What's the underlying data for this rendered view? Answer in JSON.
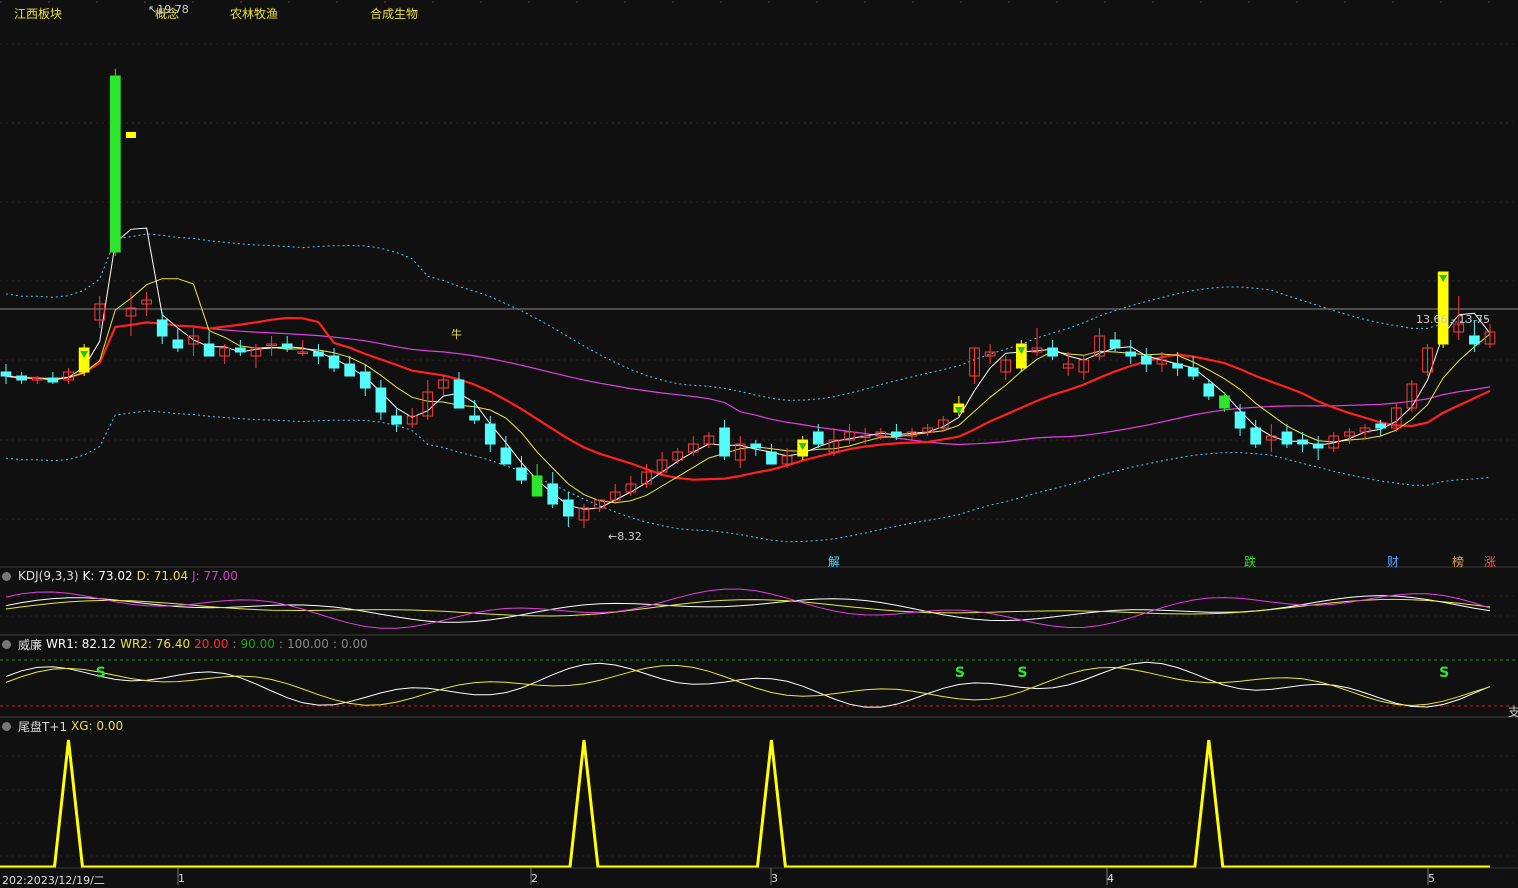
{
  "sector_labels": [
    "江西板块",
    "概念",
    "农林牧渔",
    "合成生物"
  ],
  "price_labels": {
    "high": "19.78",
    "low": "8.32",
    "cursor": "13.66 - 13.75"
  },
  "event_tags": [
    {
      "text": "解",
      "color": "#4fd6ff"
    },
    {
      "text": "跌",
      "color": "#2ee62e"
    },
    {
      "text": "财",
      "color": "#4fa6ff"
    },
    {
      "text": "榜",
      "color": "#e0a050"
    },
    {
      "text": "涨",
      "color": "#ff5050"
    }
  ],
  "niu_label": "牛",
  "kdj": {
    "name": "KDJ(9,3,3)",
    "k": "K: 73.02",
    "d": "D: 71.04",
    "j": "J: 77.00"
  },
  "wr": {
    "name": "威廉",
    "wr1": "WR1: 82.12",
    "wr2": "WR2: 76.40",
    "l20": "20.00",
    "l90": "90.00",
    "l100": "100.00",
    "l0": "0.00",
    "side": "支"
  },
  "tail": {
    "name": "尾盘T+1",
    "xg": "XG: 0.00"
  },
  "x_axis": {
    "date": "202:2023/12/19/二",
    "months": [
      "1",
      "2",
      "3",
      "4",
      "5"
    ]
  },
  "colors": {
    "up": "#ff3b3b",
    "down": "#54fcfc",
    "signal": "#ffff00",
    "ma_red": "#ff2020",
    "ma_magenta": "#e040e0",
    "ma_yellow": "#e8e840",
    "ma_white": "#ffffff",
    "boll": "#58c8e8"
  },
  "chart_data": {
    "type": "candlestick",
    "candles": [
      [
        12.2,
        12.4,
        11.9,
        12.1
      ],
      [
        12.1,
        12.2,
        11.9,
        12.0
      ],
      [
        12.0,
        12.1,
        11.9,
        12.05
      ],
      [
        12.05,
        12.2,
        11.9,
        11.95
      ],
      [
        12.0,
        12.3,
        11.9,
        12.2
      ],
      [
        12.2,
        12.9,
        12.1,
        12.8
      ],
      [
        13.5,
        14.1,
        13.3,
        13.9
      ],
      [
        15.2,
        19.78,
        15.1,
        19.6
      ],
      [
        13.6,
        14.2,
        13.1,
        13.8
      ],
      [
        13.9,
        14.2,
        13.6,
        14.0
      ],
      [
        13.5,
        13.7,
        12.9,
        13.1
      ],
      [
        13.0,
        13.3,
        12.7,
        12.8
      ],
      [
        12.9,
        13.3,
        12.6,
        13.1
      ],
      [
        12.9,
        13.2,
        12.7,
        12.6
      ],
      [
        12.6,
        12.9,
        12.4,
        12.8
      ],
      [
        12.8,
        13.0,
        12.6,
        12.7
      ],
      [
        12.6,
        12.9,
        12.3,
        12.8
      ],
      [
        12.9,
        13.1,
        12.6,
        12.9
      ],
      [
        12.9,
        13.1,
        12.7,
        12.8
      ],
      [
        12.7,
        13.0,
        12.6,
        12.7
      ],
      [
        12.7,
        12.9,
        12.4,
        12.6
      ],
      [
        12.6,
        12.8,
        12.2,
        12.3
      ],
      [
        12.4,
        12.6,
        12.2,
        12.1
      ],
      [
        12.2,
        12.4,
        11.6,
        11.8
      ],
      [
        11.8,
        12.0,
        11.0,
        11.2
      ],
      [
        11.1,
        11.3,
        10.7,
        10.9
      ],
      [
        10.9,
        11.3,
        10.8,
        11.1
      ],
      [
        11.1,
        12.0,
        11.0,
        11.7
      ],
      [
        11.8,
        12.1,
        11.6,
        12.0
      ],
      [
        12.0,
        12.2,
        11.7,
        11.3
      ],
      [
        11.1,
        11.5,
        10.9,
        11.0
      ],
      [
        10.9,
        11.1,
        10.2,
        10.4
      ],
      [
        10.3,
        10.6,
        10.1,
        9.9
      ],
      [
        9.8,
        10.1,
        9.4,
        9.5
      ],
      [
        9.6,
        9.9,
        9.3,
        9.1
      ],
      [
        9.4,
        9.7,
        8.8,
        8.9
      ],
      [
        9.0,
        9.2,
        8.32,
        8.6
      ],
      [
        8.5,
        8.9,
        8.3,
        8.8
      ],
      [
        8.8,
        9.0,
        8.7,
        9.0
      ],
      [
        9.0,
        9.4,
        8.9,
        9.2
      ],
      [
        9.2,
        9.6,
        9.1,
        9.4
      ],
      [
        9.4,
        9.9,
        9.3,
        9.7
      ],
      [
        9.7,
        10.2,
        9.6,
        10.0
      ],
      [
        10.0,
        10.3,
        9.9,
        10.2
      ],
      [
        10.2,
        10.6,
        10.1,
        10.4
      ],
      [
        10.4,
        10.7,
        10.3,
        10.6
      ],
      [
        10.8,
        11.0,
        10.0,
        10.1
      ],
      [
        10.0,
        10.6,
        9.8,
        10.4
      ],
      [
        10.4,
        10.5,
        10.1,
        10.3
      ],
      [
        10.2,
        10.4,
        10.0,
        9.9
      ],
      [
        9.9,
        10.3,
        9.8,
        10.1
      ],
      [
        10.1,
        10.6,
        10.0,
        10.5
      ],
      [
        10.7,
        10.9,
        10.3,
        10.4
      ],
      [
        10.2,
        10.8,
        10.1,
        10.5
      ],
      [
        10.5,
        10.9,
        10.4,
        10.7
      ],
      [
        10.6,
        10.8,
        10.4,
        10.6
      ],
      [
        10.6,
        10.8,
        10.5,
        10.7
      ],
      [
        10.7,
        10.9,
        10.5,
        10.6
      ],
      [
        10.6,
        10.8,
        10.5,
        10.7
      ],
      [
        10.7,
        10.9,
        10.6,
        10.8
      ],
      [
        10.8,
        11.1,
        10.7,
        11.0
      ],
      [
        11.2,
        11.6,
        11.1,
        11.4
      ],
      [
        12.1,
        12.8,
        11.9,
        12.8
      ],
      [
        12.6,
        12.9,
        12.4,
        12.7
      ],
      [
        12.2,
        12.6,
        12.0,
        12.5
      ],
      [
        12.3,
        13.0,
        12.2,
        12.9
      ],
      [
        12.7,
        13.3,
        12.6,
        12.8
      ],
      [
        12.8,
        13.0,
        12.5,
        12.6
      ],
      [
        12.3,
        12.7,
        12.1,
        12.4
      ],
      [
        12.2,
        12.6,
        12.0,
        12.5
      ],
      [
        12.6,
        13.3,
        12.5,
        13.1
      ],
      [
        13.0,
        13.2,
        12.7,
        12.8
      ],
      [
        12.7,
        13.0,
        12.4,
        12.6
      ],
      [
        12.6,
        12.8,
        12.2,
        12.4
      ],
      [
        12.4,
        12.7,
        12.2,
        12.5
      ],
      [
        12.4,
        12.7,
        12.1,
        12.3
      ],
      [
        12.3,
        12.6,
        12.0,
        12.1
      ],
      [
        11.9,
        12.0,
        11.5,
        11.6
      ],
      [
        11.6,
        11.7,
        11.2,
        11.3
      ],
      [
        11.2,
        11.4,
        10.6,
        10.8
      ],
      [
        10.8,
        11.0,
        10.3,
        10.4
      ],
      [
        10.5,
        10.9,
        10.2,
        10.6
      ],
      [
        10.7,
        10.9,
        10.3,
        10.4
      ],
      [
        10.5,
        10.7,
        10.2,
        10.4
      ],
      [
        10.4,
        10.6,
        10.0,
        10.3
      ],
      [
        10.3,
        10.7,
        10.2,
        10.6
      ],
      [
        10.6,
        10.8,
        10.4,
        10.7
      ],
      [
        10.7,
        10.9,
        10.5,
        10.8
      ],
      [
        10.9,
        11.0,
        10.6,
        10.8
      ],
      [
        10.8,
        11.4,
        10.7,
        11.3
      ],
      [
        11.3,
        12.0,
        11.2,
        11.9
      ],
      [
        12.2,
        12.9,
        12.1,
        12.8
      ],
      [
        12.9,
        13.9,
        12.8,
        14.7
      ],
      [
        13.2,
        14.1,
        13.0,
        13.4
      ],
      [
        13.1,
        13.5,
        12.7,
        12.9
      ],
      [
        12.9,
        13.4,
        12.8,
        13.2
      ]
    ],
    "series": [
      {
        "name": "KDJ K",
        "values": [
          73.02
        ]
      },
      {
        "name": "KDJ D",
        "values": [
          71.04
        ]
      },
      {
        "name": "KDJ J",
        "values": [
          77.0
        ]
      },
      {
        "name": "WR1",
        "values": [
          82.12
        ]
      },
      {
        "name": "WR2",
        "values": [
          76.4
        ]
      },
      {
        "name": "XG",
        "values": [
          0.0
        ]
      }
    ],
    "ylim": [
      8.0,
      21.0
    ]
  }
}
